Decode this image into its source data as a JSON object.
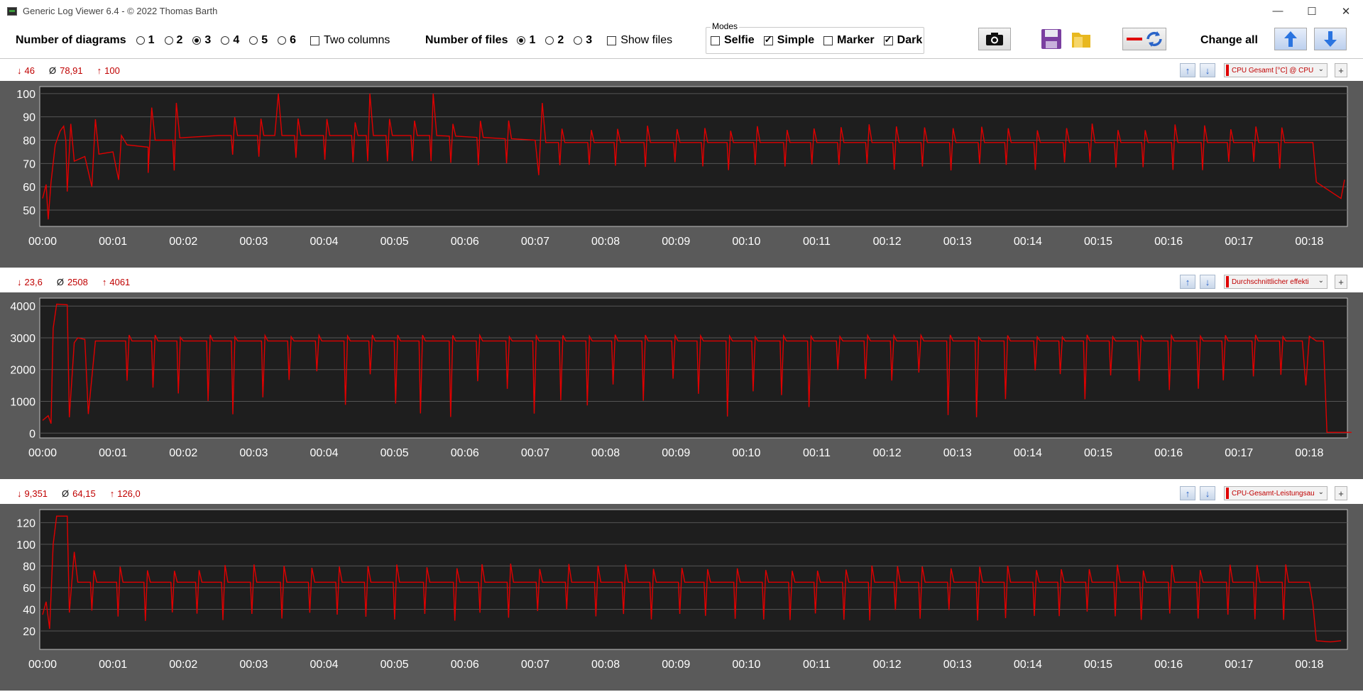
{
  "window": {
    "title": "Generic Log Viewer 6.4 - © 2022 Thomas Barth",
    "minimize": "—",
    "maximize": "☐",
    "close": "✕"
  },
  "toolbar": {
    "num_diagrams_label": "Number of diagrams",
    "diagram_options": [
      "1",
      "2",
      "3",
      "4",
      "5",
      "6"
    ],
    "diagram_selected": "3",
    "two_columns_label": "Two columns",
    "two_columns_checked": false,
    "num_files_label": "Number of files",
    "file_options": [
      "1",
      "2",
      "3"
    ],
    "file_selected": "1",
    "show_files_label": "Show files",
    "show_files_checked": false,
    "modes_legend": "Modes",
    "modes": [
      {
        "label": "Selfie",
        "checked": false
      },
      {
        "label": "Simple",
        "checked": true
      },
      {
        "label": "Marker",
        "checked": false
      },
      {
        "label": "Dark",
        "checked": true
      }
    ],
    "change_all_label": "Change all",
    "icons": [
      "camera-icon",
      "save-icon",
      "folder-icon",
      "line-color-icon",
      "refresh-icon",
      "arrow-up-icon",
      "arrow-down-icon"
    ]
  },
  "charts": [
    {
      "stats": {
        "min": "46",
        "avg": "78,91",
        "max": "100"
      },
      "sensor": "CPU Gesamt [°C] @ CPU [",
      "color": "#e00000"
    },
    {
      "stats": {
        "min": "23,6",
        "avg": "2508",
        "max": "4061"
      },
      "sensor": "Durchschnittlicher effekti",
      "color": "#e00000"
    },
    {
      "stats": {
        "min": "9,351",
        "avg": "64,15",
        "max": "126,0"
      },
      "sensor": "CPU-Gesamt-Leistungsau",
      "color": "#e00000"
    }
  ],
  "chart_data": [
    {
      "type": "line",
      "x_ticks": [
        "00:00",
        "00:01",
        "00:02",
        "00:03",
        "00:04",
        "00:05",
        "00:06",
        "00:07",
        "00:08",
        "00:09",
        "00:10",
        "00:11",
        "00:12",
        "00:13",
        "00:14",
        "00:15",
        "00:16",
        "00:17",
        "00:18"
      ],
      "y_ticks": [
        50,
        60,
        70,
        80,
        90,
        100
      ],
      "ylim": [
        43,
        103
      ],
      "xlim": [
        0,
        18.5
      ],
      "baseline": 79,
      "series": [
        {
          "color": "#e00000",
          "points": [
            [
              0,
              55
            ],
            [
              0.05,
              61
            ],
            [
              0.08,
              46
            ],
            [
              0.12,
              62
            ],
            [
              0.18,
              78
            ],
            [
              0.25,
              84
            ],
            [
              0.3,
              86
            ],
            [
              0.33,
              80
            ],
            [
              0.35,
              58
            ],
            [
              0.4,
              87
            ],
            [
              0.45,
              71
            ],
            [
              0.6,
              73
            ],
            [
              0.7,
              60
            ],
            [
              0.75,
              89
            ],
            [
              0.8,
              74
            ],
            [
              1,
              75
            ],
            [
              1.08,
              63
            ],
            [
              1.12,
              82
            ],
            [
              1.2,
              78
            ],
            [
              1.5,
              77
            ],
            [
              1.5,
              66
            ],
            [
              1.55,
              94
            ],
            [
              1.6,
              80
            ],
            [
              1.85,
              80
            ],
            [
              1.87,
              67
            ],
            [
              1.9,
              96
            ],
            [
              1.95,
              81
            ],
            [
              2.5,
              82
            ],
            [
              3.3,
              82
            ],
            [
              3.35,
              100
            ],
            [
              3.4,
              82
            ],
            [
              4.6,
              82
            ],
            [
              4.62,
              71
            ],
            [
              4.65,
              100
            ],
            [
              4.7,
              82
            ],
            [
              5.5,
              82
            ],
            [
              5.52,
              71
            ],
            [
              5.55,
              100
            ],
            [
              5.6,
              82
            ],
            [
              7,
              80
            ],
            [
              7.05,
              65
            ],
            [
              7.1,
              96
            ],
            [
              7.15,
              79
            ],
            [
              18.05,
              79
            ],
            [
              18.1,
              62
            ],
            [
              18.3,
              58
            ],
            [
              18.45,
              55
            ],
            [
              18.5,
              63
            ]
          ]
        }
      ]
    },
    {
      "type": "line",
      "x_ticks": [
        "00:00",
        "00:01",
        "00:02",
        "00:03",
        "00:04",
        "00:05",
        "00:06",
        "00:07",
        "00:08",
        "00:09",
        "00:10",
        "00:11",
        "00:12",
        "00:13",
        "00:14",
        "00:15",
        "00:16",
        "00:17",
        "00:18"
      ],
      "y_ticks": [
        0,
        1000,
        2000,
        3000,
        4000
      ],
      "ylim": [
        -150,
        4250
      ],
      "xlim": [
        0,
        18.5
      ],
      "baseline": 2880,
      "series": [
        {
          "color": "#e00000",
          "points": [
            [
              0,
              400
            ],
            [
              0.08,
              550
            ],
            [
              0.12,
              300
            ],
            [
              0.15,
              3300
            ],
            [
              0.2,
              4061
            ],
            [
              0.35,
              4040
            ],
            [
              0.38,
              500
            ],
            [
              0.45,
              2850
            ],
            [
              0.5,
              3000
            ],
            [
              0.6,
              2950
            ],
            [
              0.65,
              600
            ],
            [
              0.75,
              2900
            ],
            [
              1,
              2900
            ],
            [
              17.9,
              2900
            ],
            [
              17.95,
              1500
            ],
            [
              18.0,
              3050
            ],
            [
              18.1,
              2900
            ],
            [
              18.2,
              2900
            ],
            [
              18.25,
              24
            ],
            [
              18.6,
              24
            ]
          ]
        }
      ]
    },
    {
      "type": "line",
      "x_ticks": [
        "00:00",
        "00:01",
        "00:02",
        "00:03",
        "00:04",
        "00:05",
        "00:06",
        "00:07",
        "00:08",
        "00:09",
        "00:10",
        "00:11",
        "00:12",
        "00:13",
        "00:14",
        "00:15",
        "00:16",
        "00:17",
        "00:18"
      ],
      "y_ticks": [
        20,
        40,
        60,
        80,
        100,
        120
      ],
      "ylim": [
        3,
        132
      ],
      "xlim": [
        0,
        18.5
      ],
      "baseline": 65,
      "series": [
        {
          "color": "#e00000",
          "points": [
            [
              0,
              35
            ],
            [
              0.05,
              47
            ],
            [
              0.1,
              22
            ],
            [
              0.15,
              100
            ],
            [
              0.2,
              126
            ],
            [
              0.35,
              126
            ],
            [
              0.38,
              37
            ],
            [
              0.45,
              93
            ],
            [
              0.5,
              65
            ],
            [
              18,
              65
            ],
            [
              18.05,
              45
            ],
            [
              18.1,
              11
            ],
            [
              18.3,
              10
            ],
            [
              18.45,
              11
            ]
          ]
        }
      ]
    }
  ]
}
